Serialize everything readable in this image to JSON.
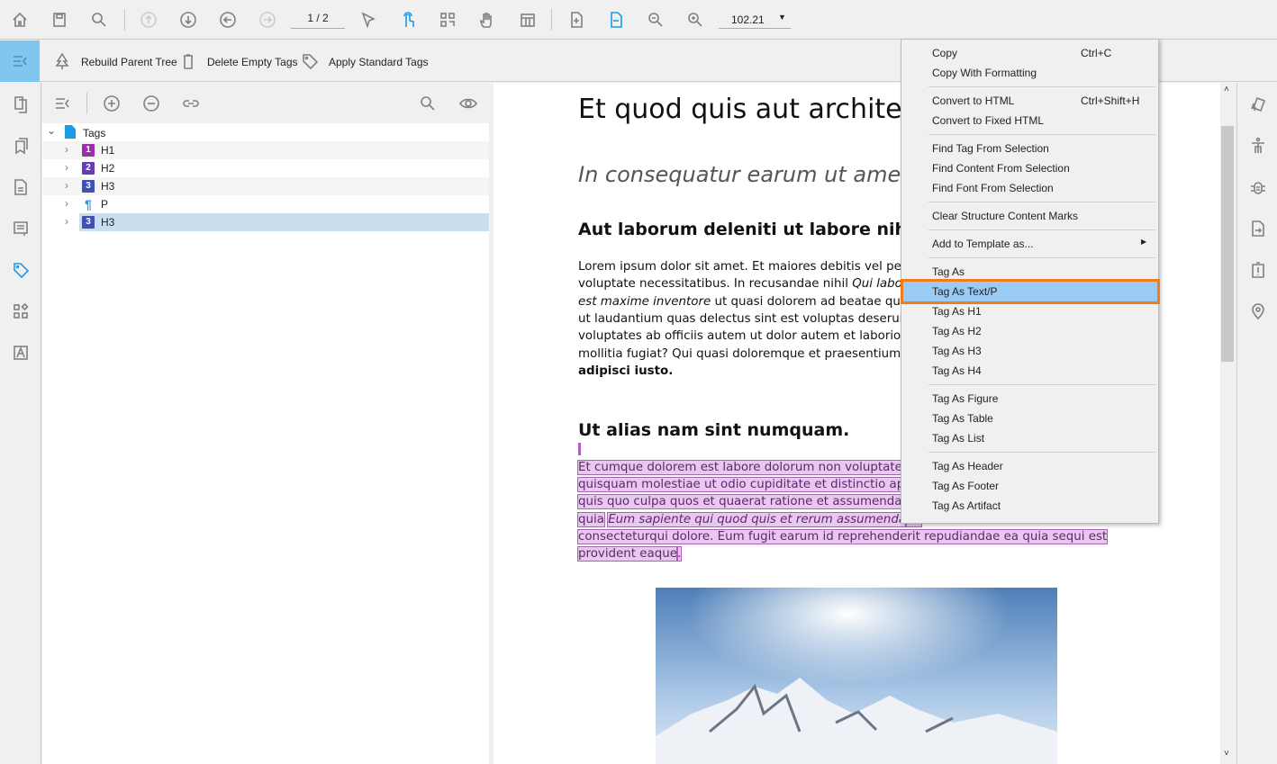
{
  "toolbar": {
    "page_indicator": "1 / 2",
    "zoom_value": "102.21",
    "accent": "#1a9be6"
  },
  "toolbar2": {
    "rebuild": "Rebuild Parent Tree",
    "delete_empty": "Delete Empty Tags",
    "apply_standard": "Apply Standard Tags"
  },
  "tree": {
    "root": "Tags",
    "items": [
      {
        "label": "H1",
        "badge": "1",
        "color": "#9b2fae"
      },
      {
        "label": "H2",
        "badge": "2",
        "color": "#6a3ab8"
      },
      {
        "label": "H3",
        "badge": "3",
        "color": "#3f51b5"
      },
      {
        "label": "P",
        "badge": "¶",
        "color": "#1a9be6"
      },
      {
        "label": "H3",
        "badge": "3",
        "color": "#3f51b5",
        "selected": true
      }
    ]
  },
  "document": {
    "title": "Et quod quis aut architec",
    "subtitle": "In consequatur earum ut amet",
    "heading1": "Aut laborum deleniti ut labore nihil.",
    "para1": [
      "Lorem ipsum dolor sit amet. Et maiores debitis vel persp",
      "voluptate necessitatibus. In recusandae nihil ",
      "ut quasi dolorem ad beatae quia.",
      "ut laudantium quas delectus sint est voluptas deserunt",
      "voluptates ab officiis autem ut dolor autem et laboriosa",
      "mollitia fugiat? Qui quasi doloremque et praesentium si",
      "adipisci iusto."
    ],
    "para1_italic": [
      "Qui laboric",
      "est maxime inventore"
    ],
    "heading2": "Ut alias nam sint numquam.",
    "para2": [
      "Et cumque dolorem est labore dolorum non voluptate r",
      "quisquam molestiae ut odio cupiditate et distinctio aper",
      "quis quo culpa quos et quaerat ratione et assumenda di",
      "quia",
      "Eum sapiente qui quod quis et rerum assumenda",
      ". E",
      "consecteturqui dolore. Eum fugit earum id reprehenderit repudiandae ea quia sequi est",
      "provident eaque",
      "."
    ]
  },
  "context_menu": {
    "items": [
      {
        "label": "Copy",
        "shortcut": "Ctrl+C"
      },
      {
        "label": "Copy With Formatting"
      },
      {
        "label": "Convert to HTML",
        "shortcut": "Ctrl+Shift+H"
      },
      {
        "label": "Convert to Fixed HTML"
      },
      {
        "label": "Find Tag From Selection"
      },
      {
        "label": "Find Content From Selection"
      },
      {
        "label": "Find Font From Selection"
      },
      {
        "label": "Clear Structure Content Marks"
      },
      {
        "label": "Add to Template as...",
        "submenu": true
      },
      {
        "label": "Tag As"
      },
      {
        "label": "Tag As Text/P",
        "highlighted": true
      },
      {
        "label": "Tag As H1"
      },
      {
        "label": "Tag As H2"
      },
      {
        "label": "Tag As H3"
      },
      {
        "label": "Tag As H4"
      },
      {
        "label": "Tag As Figure"
      },
      {
        "label": "Tag As Table"
      },
      {
        "label": "Tag As List"
      },
      {
        "label": "Tag As Header"
      },
      {
        "label": "Tag As Footer"
      },
      {
        "label": "Tag As Artifact"
      }
    ],
    "highlight_color": "#99cbf5",
    "focus_border": "#f07d1a"
  }
}
